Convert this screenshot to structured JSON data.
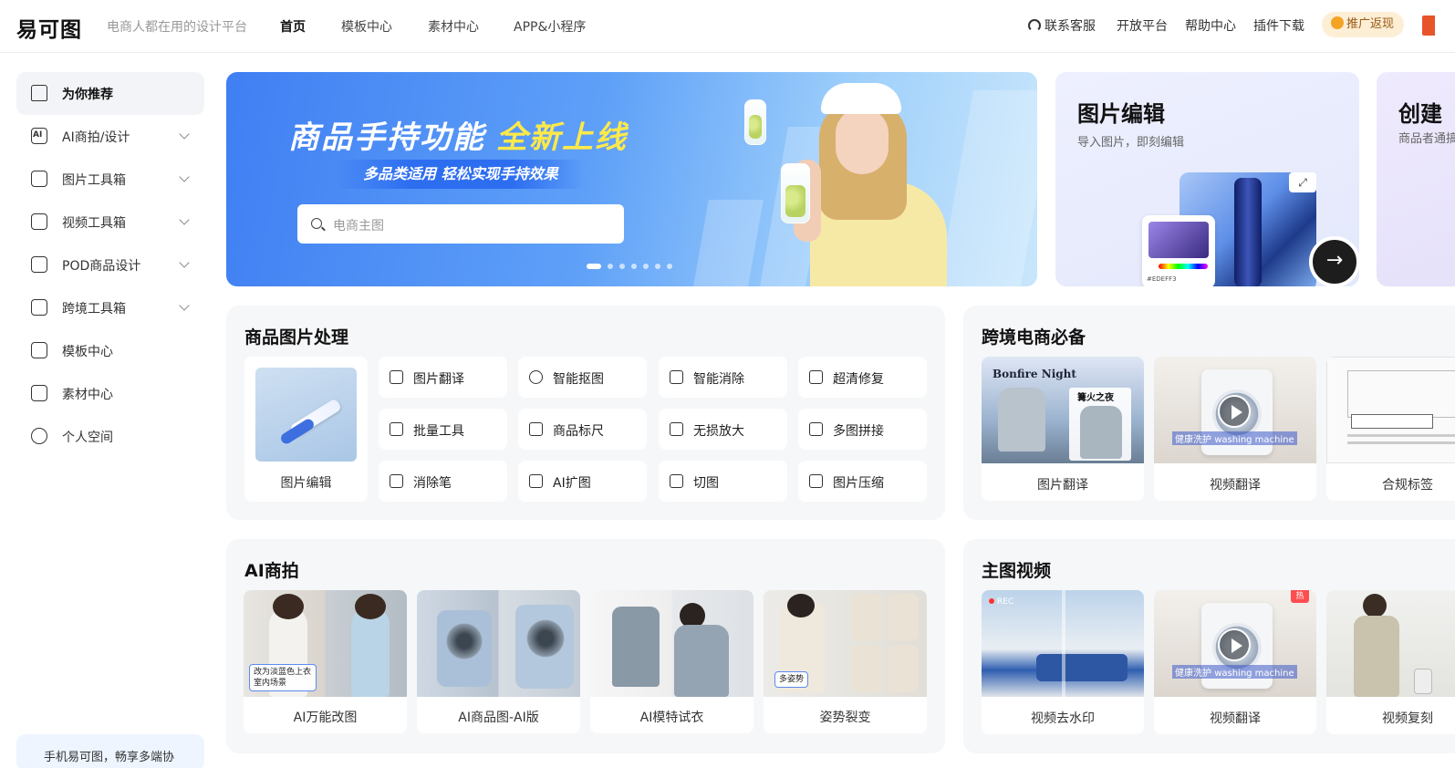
{
  "header": {
    "logo": "易可图",
    "slogan": "电商人都在用的设计平台",
    "nav": [
      "首页",
      "模板中心",
      "素材中心",
      "APP&小程序"
    ],
    "right": [
      "联系客服",
      "开放平台",
      "帮助中心",
      "插件下载"
    ],
    "promo": "推广返现"
  },
  "sidebar": {
    "items": [
      {
        "label": "为你推荐",
        "icon": "home-icon"
      },
      {
        "label": "AI商拍/设计",
        "icon": "ai-icon"
      },
      {
        "label": "图片工具箱",
        "icon": "toolbox-icon"
      },
      {
        "label": "视频工具箱",
        "icon": "video-icon"
      },
      {
        "label": "POD商品设计",
        "icon": "pod-icon"
      },
      {
        "label": "跨境工具箱",
        "icon": "crossborder-icon"
      },
      {
        "label": "模板中心",
        "icon": "template-icon"
      },
      {
        "label": "素材中心",
        "icon": "material-icon"
      },
      {
        "label": "个人空间",
        "icon": "user-icon"
      }
    ],
    "footer": "手机易可图，畅享多端协"
  },
  "banner": {
    "title_white": "商品手持功能",
    "title_yellow": "全新上线",
    "subtitle": "多品类适用 轻松实现手持效果",
    "search_placeholder": "电商主图",
    "dots": 7,
    "active_dot": 0
  },
  "card_edit": {
    "title": "图片编辑",
    "subtitle": "导入图片，即刻编辑",
    "hex": "#EDEFF3"
  },
  "card_create": {
    "title": "创建",
    "subtitle": "商品者通搞定"
  },
  "panel_product": {
    "title": "商品图片处理",
    "feature": "图片编辑",
    "tools": [
      "图片翻译",
      "智能抠图",
      "智能消除",
      "超清修复",
      "批量工具",
      "商品标尺",
      "无损放大",
      "多图拼接",
      "消除笔",
      "AI扩图",
      "切图",
      "图片压缩"
    ]
  },
  "panel_cross": {
    "title": "跨境电商必备",
    "cards": [
      "图片翻译",
      "视频翻译",
      "合规标签"
    ],
    "overlay": {
      "bonfire": "Bonfire Night",
      "cn": "篝火之夜",
      "washer": "washing machine",
      "washer_cn": "健康洗护"
    }
  },
  "panel_ai": {
    "title": "AI商拍",
    "cards": [
      "AI万能改图",
      "AI商品图-AI版",
      "AI模特试衣",
      "姿势裂变"
    ],
    "tags": {
      "change": "改为淡蓝色上衣 室内场景",
      "pose": "多姿势"
    }
  },
  "panel_video": {
    "title": "主图视频",
    "cards": [
      "视频去水印",
      "视频翻译",
      "视频复刻"
    ],
    "rec": "REC",
    "hot": "热"
  },
  "colors": {
    "accent": "#3f7ff3",
    "highlight": "#ffe94a",
    "promo_bg": "#fdeed6"
  }
}
